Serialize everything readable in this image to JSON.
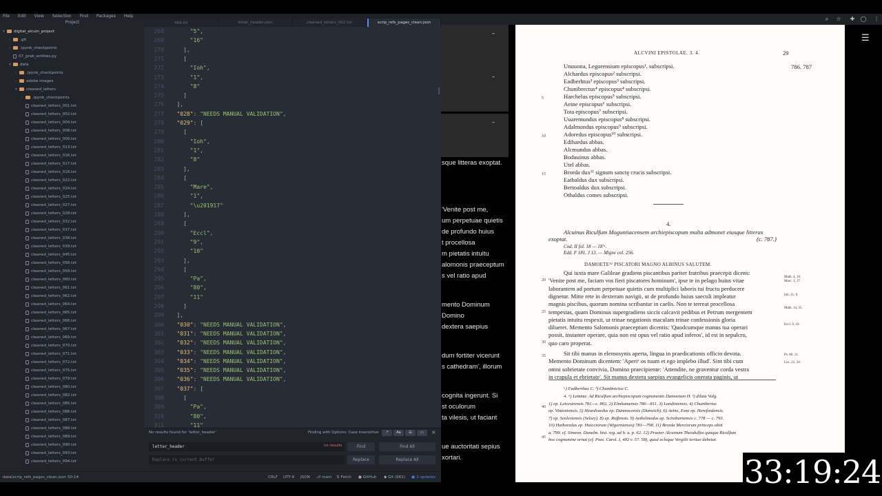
{
  "menubar": [
    "File",
    "Edit",
    "View",
    "Selection",
    "Find",
    "Packages",
    "Help"
  ],
  "tree": {
    "header": "Project",
    "items": [
      {
        "label": "digital_alcuin_project",
        "kind": "folder",
        "depth": 0,
        "open": true
      },
      {
        "label": ".git",
        "kind": "folder",
        "depth": 1,
        "open": false
      },
      {
        "label": ".ipynb_checkpoints",
        "kind": "folder",
        "depth": 1,
        "open": false
      },
      {
        "label": "07_grab_entities.py",
        "kind": "file",
        "depth": 1
      },
      {
        "label": "data",
        "kind": "folder",
        "depth": 1,
        "open": true
      },
      {
        "label": ".ipynb_checkpoints",
        "kind": "folder",
        "depth": 2,
        "open": false
      },
      {
        "label": "adobe images",
        "kind": "folder",
        "depth": 2,
        "open": false
      },
      {
        "label": "cleaned_letters",
        "kind": "folder",
        "depth": 2,
        "open": true
      },
      {
        "label": ".ipynb_checkpoints",
        "kind": "folder",
        "depth": 3,
        "open": false
      },
      {
        "label": "cleaned_letters_001.txt",
        "kind": "file",
        "depth": 3
      },
      {
        "label": "cleaned_letters_002.txt",
        "kind": "file",
        "depth": 3
      },
      {
        "label": "cleaned_letters_004.txt",
        "kind": "file",
        "depth": 3
      },
      {
        "label": "cleaned_letters_008.txt",
        "kind": "file",
        "depth": 3
      },
      {
        "label": "cleaned_letters_009.txt",
        "kind": "file",
        "depth": 3
      },
      {
        "label": "cleaned_letters_013.txt",
        "kind": "file",
        "depth": 3
      },
      {
        "label": "cleaned_letters_016.txt",
        "kind": "file",
        "depth": 3
      },
      {
        "label": "cleaned_letters_017.txt",
        "kind": "file",
        "depth": 3
      },
      {
        "label": "cleaned_letters_018.txt",
        "kind": "file",
        "depth": 3
      },
      {
        "label": "cleaned_letters_022.txt",
        "kind": "file",
        "depth": 3
      },
      {
        "label": "cleaned_letters_024.txt",
        "kind": "file",
        "depth": 3
      },
      {
        "label": "cleaned_letters_025.txt",
        "kind": "file",
        "depth": 3
      },
      {
        "label": "cleaned_letters_027.txt",
        "kind": "file",
        "depth": 3
      },
      {
        "label": "cleaned_letters_028.txt",
        "kind": "file",
        "depth": 3
      },
      {
        "label": "cleaned_letters_032.txt",
        "kind": "file",
        "depth": 3
      },
      {
        "label": "cleaned_letters_037.txt",
        "kind": "file",
        "depth": 3
      },
      {
        "label": "cleaned_letters_038.txt",
        "kind": "file",
        "depth": 3
      },
      {
        "label": "cleaned_letters_039.txt",
        "kind": "file",
        "depth": 3
      },
      {
        "label": "cleaned_letters_045.txt",
        "kind": "file",
        "depth": 3
      },
      {
        "label": "cleaned_letters_058.txt",
        "kind": "file",
        "depth": 3
      },
      {
        "label": "cleaned_letters_059.txt",
        "kind": "file",
        "depth": 3
      },
      {
        "label": "cleaned_letters_060.txt",
        "kind": "file",
        "depth": 3
      },
      {
        "label": "cleaned_letters_061.txt",
        "kind": "file",
        "depth": 3
      },
      {
        "label": "cleaned_letters_062.txt",
        "kind": "file",
        "depth": 3
      },
      {
        "label": "cleaned_letters_064.txt",
        "kind": "file",
        "depth": 3
      },
      {
        "label": "cleaned_letters_065.txt",
        "kind": "file",
        "depth": 3
      },
      {
        "label": "cleaned_letters_066.txt",
        "kind": "file",
        "depth": 3
      },
      {
        "label": "cleaned_letters_067.txt",
        "kind": "file",
        "depth": 3
      },
      {
        "label": "cleaned_letters_069.txt",
        "kind": "file",
        "depth": 3
      },
      {
        "label": "cleaned_letters_070.txt",
        "kind": "file",
        "depth": 3
      },
      {
        "label": "cleaned_letters_071.txt",
        "kind": "file",
        "depth": 3
      },
      {
        "label": "cleaned_letters_072.txt",
        "kind": "file",
        "depth": 3
      },
      {
        "label": "cleaned_letters_075.txt",
        "kind": "file",
        "depth": 3
      },
      {
        "label": "cleaned_letters_079.txt",
        "kind": "file",
        "depth": 3
      },
      {
        "label": "cleaned_letters_080.txt",
        "kind": "file",
        "depth": 3
      },
      {
        "label": "cleaned_letters_082.txt",
        "kind": "file",
        "depth": 3
      },
      {
        "label": "cleaned_letters_085.txt",
        "kind": "file",
        "depth": 3
      },
      {
        "label": "cleaned_letters_086.txt",
        "kind": "file",
        "depth": 3
      },
      {
        "label": "cleaned_letters_087.txt",
        "kind": "file",
        "depth": 3
      },
      {
        "label": "cleaned_letters_088.txt",
        "kind": "file",
        "depth": 3
      },
      {
        "label": "cleaned_letters_089.txt",
        "kind": "file",
        "depth": 3
      },
      {
        "label": "cleaned_letters_090.txt",
        "kind": "file",
        "depth": 3
      },
      {
        "label": "cleaned_letters_093.txt",
        "kind": "file",
        "depth": 3
      },
      {
        "label": "cleaned_letters_094.txt",
        "kind": "file",
        "depth": 3
      }
    ]
  },
  "tabs": [
    {
      "label": "app.py",
      "active": false
    },
    {
      "label": "letter_header.json",
      "active": false
    },
    {
      "label": "cleaned_letters_002.txt",
      "active": false
    },
    {
      "label": "scrip_refs_pages_clean.json",
      "active": true
    }
  ],
  "code": [
    {
      "n": "268",
      "indent": 12,
      "text": "\"5\","
    },
    {
      "n": "269",
      "indent": 12,
      "text": "\"16\""
    },
    {
      "n": "270",
      "indent": 8,
      "text": "],"
    },
    {
      "n": "271",
      "indent": 8,
      "text": "["
    },
    {
      "n": "272",
      "indent": 12,
      "text": "\"Ioh\","
    },
    {
      "n": "273",
      "indent": 12,
      "text": "\"1\","
    },
    {
      "n": "274",
      "indent": 12,
      "text": "\"8\""
    },
    {
      "n": "275",
      "indent": 8,
      "text": "]"
    },
    {
      "n": "276",
      "indent": 4,
      "text": "],"
    },
    {
      "n": "277",
      "indent": 4,
      "text": "\"028\": \"NEEDS MANUAL VALIDATION\","
    },
    {
      "n": "278",
      "indent": 4,
      "text": "\"029\": ["
    },
    {
      "n": "279",
      "indent": 8,
      "text": "["
    },
    {
      "n": "280",
      "indent": 12,
      "text": "\"Ioh\","
    },
    {
      "n": "281",
      "indent": 12,
      "text": "\"1\","
    },
    {
      "n": "282",
      "indent": 12,
      "text": "\"8\""
    },
    {
      "n": "283",
      "indent": 8,
      "text": "],"
    },
    {
      "n": "284",
      "indent": 8,
      "text": "["
    },
    {
      "n": "285",
      "indent": 12,
      "text": "\"Mare\","
    },
    {
      "n": "286",
      "indent": 12,
      "text": "\"1\","
    },
    {
      "n": "287",
      "indent": 12,
      "text": "\"\\u201917\""
    },
    {
      "n": "288",
      "indent": 8,
      "text": "],"
    },
    {
      "n": "289",
      "indent": 8,
      "text": "["
    },
    {
      "n": "290",
      "indent": 12,
      "text": "\"Eccl\","
    },
    {
      "n": "291",
      "indent": 12,
      "text": "\"9\","
    },
    {
      "n": "292",
      "indent": 12,
      "text": "\"10\""
    },
    {
      "n": "293",
      "indent": 8,
      "text": "],"
    },
    {
      "n": "294",
      "indent": 8,
      "text": "["
    },
    {
      "n": "295",
      "indent": 12,
      "text": "\"Pa\","
    },
    {
      "n": "296",
      "indent": 12,
      "text": "\"80\","
    },
    {
      "n": "297",
      "indent": 12,
      "text": "\"11\""
    },
    {
      "n": "298",
      "indent": 8,
      "text": "]"
    },
    {
      "n": "299",
      "indent": 4,
      "text": "],"
    },
    {
      "n": "300",
      "indent": 4,
      "text": "\"030\": \"NEEDS MANUAL VALIDATION\","
    },
    {
      "n": "301",
      "indent": 4,
      "text": "\"031\": \"NEEDS MANUAL VALIDATION\","
    },
    {
      "n": "302",
      "indent": 4,
      "text": "\"032\": \"NEEDS MANUAL VALIDATION\","
    },
    {
      "n": "303",
      "indent": 4,
      "text": "\"033\": \"NEEDS MANUAL VALIDATION\","
    },
    {
      "n": "304",
      "indent": 4,
      "text": "\"034\": \"NEEDS MANUAL VALIDATION\","
    },
    {
      "n": "305",
      "indent": 4,
      "text": "\"035\": \"NEEDS MANUAL VALIDATION\","
    },
    {
      "n": "306",
      "indent": 4,
      "text": "\"036\": \"NEEDS MANUAL VALIDATION\","
    },
    {
      "n": "307",
      "indent": 4,
      "text": "\"037\": ["
    },
    {
      "n": "308",
      "indent": 8,
      "text": "["
    },
    {
      "n": "309",
      "indent": 12,
      "text": "\"Pa\","
    },
    {
      "n": "310",
      "indent": 12,
      "text": "\"80\","
    },
    {
      "n": "311",
      "indent": 12,
      "text": "\"11\""
    }
  ],
  "find": {
    "status": "No results found for 'letter_header'",
    "mode": "Finding with Options: Case Insensitive",
    "options": [
      ".*",
      "Aa",
      "☰",
      "▭"
    ],
    "close": "×",
    "query": "letter_header",
    "no_results": "no results",
    "replace_placeholder": "Replace in current buffer",
    "find_label": "Find",
    "find_all_label": "Find All",
    "replace_label": "Replace",
    "replace_all_label": "Replace All"
  },
  "status": {
    "path": "data\\scrip_refs_pages_clean.json",
    "cursor": "50:14",
    "eol": "CRLF",
    "encoding": "UTF-8",
    "grammar": "JSON",
    "branch": "main",
    "fetch": "Fetch",
    "github": "GitHub",
    "git": "Git (961)",
    "updates": "2 updates"
  },
  "browser": {
    "icons": [
      "zoom-icon",
      "star-icon",
      "extensions-icon",
      "profile-icon",
      "menu-icon"
    ],
    "sidebar_dashes": [
      "–",
      "–",
      "–"
    ],
    "side_text": [
      "sque litteras exoptat.",
      "'Venite post me,",
      "um perpetuae quietis",
      "de profundo huius",
      "t procellosa",
      "m pietatis intuitu",
      "alomonis praeceptum",
      "s vel ratio apud",
      "mento Dominum",
      "Domino",
      "dextera saepius",
      "dum fortiter vicerunt",
      "s cathedram', illorum",
      "cognita ingerunt. Si",
      "st oculorum",
      "ta vilesis, ut faciant",
      "ue auctoritati sepius",
      "xortari."
    ],
    "menu": "☰"
  },
  "page": {
    "running_head": "ALCVINI EPISTOLAE. 3. 4.",
    "page_number": "29",
    "years": "786. 787",
    "signatories": [
      "Unuuona, Legorensium episcopus¹, subscripsi.",
      "Alchardus episcopus² subscripsi.",
      "Eadberhtus³ episcopus³ subscripsi.",
      "Chunibrectus⁴ episcopus⁴ subscripsi.",
      "Harchelus episcopus⁵ subscripsi.",
      "Aeine episcopus⁶ subscripsi.",
      "Tota episcopus⁷ subscripsi.",
      "Uuaremundus episcopus⁸ subscripsi.",
      "Adalmondus episcopus⁹ subscripsi.",
      "Adoredus episcopus¹⁰ subscripsi.",
      "Edihardus abbas.",
      "Alcmundus abbas.",
      "Boduuinus abbas.",
      "Utel abbas.",
      "Brorda dux¹¹ signum sanctę crucis subscripsi.",
      "Eatbaldus dux subscripsi.",
      "Bertoaldus dux subscripsi.",
      "Otbaldus comes subscripsi."
    ],
    "line_numbers_top": [
      "5",
      "10",
      "15"
    ],
    "letter_number": "4.",
    "summary_1": "Alcuinus Riculfum Moguntiacensem archiepiscopum multa admonet eiusque litteras",
    "summary_2": "exoptat.",
    "summary_date": "(c. 787.)",
    "cod": "Cod. II fol. 18 — 18'ᵃ.",
    "edd": "Edd. F 181, J 13. — Migne col. 256.",
    "salutation": "DAMOETE¹² PISCATORI MAGNO ALBINUS SALUTEM.",
    "body": [
      "Qui iuxta mare Galileae gradiens piscantibus pariter fratribus praecepit dicens:",
      "'Venite post me, faciam vos fieri piscatores hominum', ipse te in pelago huius vitae",
      "laborantem ad portum perpetuae quietis cum multiplici laboris tui fructu perducere",
      "dignetur.  Mitte rete in dexteram navigii, ut de profundo huius saeculi impleatur",
      "magnis piscibus, quorum nomina scribantur in caelis.  Non te terreat procellosa",
      "tempestas, quam Dominus supergradiens siccis calcavit pedibus et Petrum mergentem",
      "pietatis intuitu respexit, ut trinae negationis maculam trinae confessionis gloria",
      "dilueret.  Memento Salomonis praeceptum dicentis: 'Quodcumque manus tua operari",
      "possit, instanter operare, quia non est opus vel ratio apud inferos', id est in sepulcro,",
      "quo caro properat.",
      "Sit tibi manus in elemosynis aperta, lingua in praedicationis officio devota.",
      "Memento Dominum dicentem: 'Aperiᵃ os tuum et ego implebo illud'.  Sint tibi cum",
      "omni sobrietate convivia, Domino praecipiente: 'Attendite, ne graventur corda vestra",
      "in crapula et ebrietate'.  Sit manus dextera saepius evangelicis onerata paginis, ut"
    ],
    "line_numbers_body": [
      "20",
      "25",
      "30",
      "35"
    ],
    "margin_notes": [
      "Math. 4, 19.",
      "Marc. 1, 17.",
      "Ioh. 21, 6.",
      "Math. 14, 25.",
      "Eccl. 9, 10.",
      "Ps. 80, 11.",
      "Luc. 21, 34."
    ],
    "footnote_head": "ᵃ) Fadberthus C.     ᵇ) Chumbrectus C.",
    "footnotes": [
      "4. ᵃ) Lemma: Ad Riculfum archiepiscopum cognomento Damoetam H.      ᵇ) dilata Vulg.",
      "1) ep. Leicestrensis 781—c. 802.   2) Elmhamensis 786—811.   3) Londiniensis.   4) Chunibertus",
      "ep. Vintoniensis.   5) Heardraedus ep. Dunmocensis (Dunwich).   6) Aeine, Esne ep. Herefordensis.",
      "7) ep. Seolesiensis (Selsey).   8) ep. Roffensis.   9) Aethelmodus ep. Scireburnensis c. 778 — c. 793.",
      "10) Hathoredus ep. Huicciorum (Wigorniensis) 781—798.   11) Brorda Merciorum princeps obiit",
      "a. 799. cf. Simeon. Dunelm. hist. reg. ad h. a. p. 62.   12) Praeter Alcuinum Theodulfus quoque Riculfum",
      "hoc cognomine ornat (cf. Poet. Carol. I, 492 v. 57. 58), quod ecloque Vergilii tertiae debetur."
    ],
    "footnote_linenums": [
      "40",
      "45"
    ]
  },
  "clock": "33:19:24"
}
